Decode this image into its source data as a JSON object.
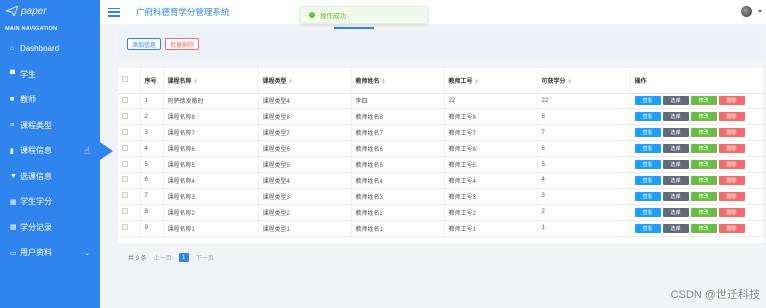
{
  "sidebar": {
    "logo": "paper",
    "header": "MAIN NAVIGATION",
    "items": [
      {
        "label": "Dashboard"
      },
      {
        "label": "学生"
      },
      {
        "label": "教师"
      },
      {
        "label": "课程类型"
      },
      {
        "label": "课程信息"
      },
      {
        "label": "选课信息"
      },
      {
        "label": "学生学分"
      },
      {
        "label": "学分记录"
      },
      {
        "label": "用户资料"
      }
    ]
  },
  "header": {
    "title": "广府科德育学分管理系统",
    "toast": "操作成功"
  },
  "toolbar": {
    "add_label": "添加信息",
    "delete_label": "批量删除"
  },
  "table": {
    "columns": [
      "序号",
      "课程名称",
      "课程类型",
      "教师姓名",
      "教师工号",
      "可获学分",
      "操作"
    ],
    "rows": [
      [
        "1",
        "阿萨德发撒时",
        "课程类型4",
        "李四",
        "22",
        "22"
      ],
      [
        "2",
        "课程名称8",
        "课程类型8",
        "教师姓名8",
        "教师工号8",
        "8"
      ],
      [
        "3",
        "课程名称7",
        "课程类型7",
        "教师姓名7",
        "教师工号7",
        "7"
      ],
      [
        "4",
        "课程名称6",
        "课程类型6",
        "教师姓名6",
        "教师工号6",
        "6"
      ],
      [
        "5",
        "课程名称5",
        "课程类型5",
        "教师姓名5",
        "教师工号5",
        "5"
      ],
      [
        "6",
        "课程名称4",
        "课程类型4",
        "教师姓名4",
        "教师工号4",
        "4"
      ],
      [
        "7",
        "课程名称3",
        "课程类型3",
        "教师姓名3",
        "教师工号3",
        "3"
      ],
      [
        "8",
        "课程名称2",
        "课程类型2",
        "教师姓名2",
        "教师工号2",
        "2"
      ],
      [
        "9",
        "课程名称1",
        "课程类型1",
        "教师姓名1",
        "教师工号1",
        "1"
      ]
    ],
    "actions": [
      "查看",
      "选课",
      "修改",
      "删除"
    ]
  },
  "pagination": {
    "total": "共 9 条",
    "prev": "上一页",
    "current": "1",
    "next": "下一页"
  },
  "watermark": "CSDN @世迁科技",
  "colors": {
    "sidebar": "#2f84ee",
    "view": "#1e9fff",
    "choose": "#5f6b78",
    "edit": "#6bbd45",
    "delete": "#f56c6c"
  }
}
